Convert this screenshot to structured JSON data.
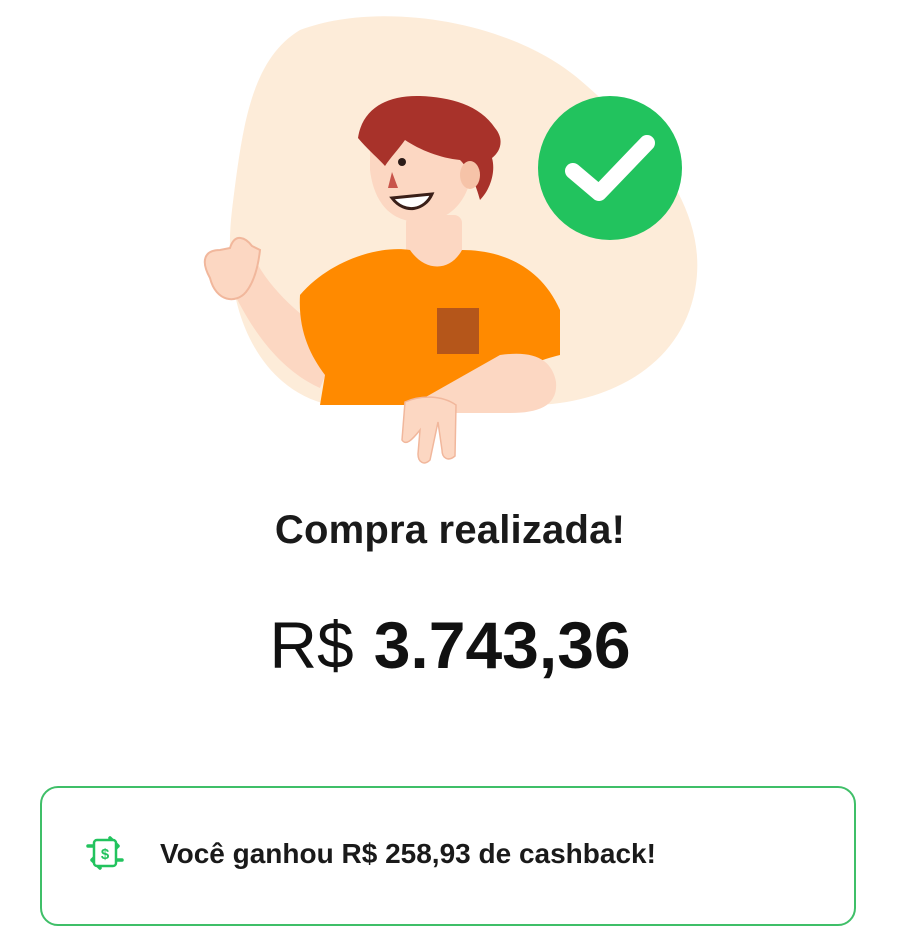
{
  "confirmation": {
    "title": "Compra realizada!",
    "amount_currency": "R$",
    "amount_value": "3.743,36"
  },
  "cashback": {
    "message": "Você ganhou R$ 258,93 de cashback!",
    "icon": "cashback-exchange-icon"
  },
  "illustration": {
    "subject": "person-thumbs-up-illustration",
    "badge_icon": "check-circle-icon"
  },
  "colors": {
    "success_green": "#22c35e",
    "card_border": "#3fbf68",
    "shirt_orange": "#ff8a00",
    "hair_red": "#a8322a",
    "blob_peach": "#fdecd9"
  }
}
